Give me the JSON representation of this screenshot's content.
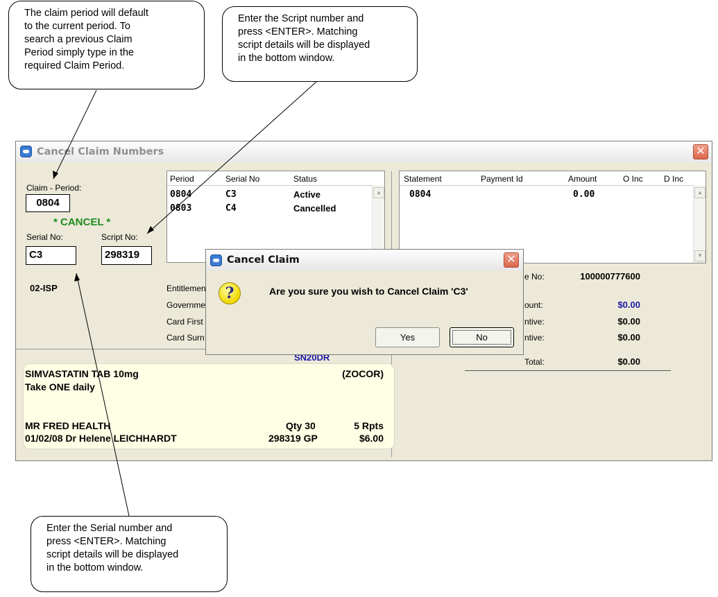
{
  "callouts": {
    "period": "The claim period will default\nto the current period. To\nsearch a previous Claim\nPeriod simply type in the\nrequired Claim Period.",
    "script": "Enter the Script number and\npress <ENTER>. Matching\nscript details will be displayed\nin the bottom window.",
    "serial": "Enter the Serial number and\npress <ENTER>. Matching\nscript details will be displayed\nin the bottom window."
  },
  "window": {
    "title": "Cancel Claim Numbers",
    "claim_period_label": "Claim - Period:",
    "claim_period_value": "0804",
    "cancel_banner": "* CANCEL *",
    "serial_label": "Serial No:",
    "serial_value": "C3",
    "script_label": "Script No:",
    "script_value": "298319",
    "code": "02-ISP",
    "left_labels": [
      "Entitlemen",
      "Governme",
      "Card First",
      "Card Surn"
    ],
    "blue_code": "SN20DR"
  },
  "claims_list": {
    "headers": [
      "Period",
      "Serial No",
      "Status"
    ],
    "rows": [
      {
        "period": "0804",
        "serial": "C3",
        "status": "Active"
      },
      {
        "period": "0803",
        "serial": "C4",
        "status": "Cancelled"
      }
    ]
  },
  "statements_list": {
    "headers": [
      "Statement",
      "Payment Id",
      "Amount",
      "O Inc",
      "D Inc"
    ],
    "rows": [
      {
        "statement": "0804",
        "payment_id": "",
        "amount": "0.00"
      }
    ]
  },
  "totals": {
    "labels": [
      "e No:",
      "ount:",
      "ntive:",
      "ntive:",
      "Total:"
    ],
    "values": [
      "100000777600",
      "$0.00",
      "$0.00",
      "$0.00",
      "$0.00"
    ],
    "value_colors": [
      "#000000",
      "#1a1aa6",
      "#000000",
      "#000000",
      "#000000"
    ]
  },
  "script_details": {
    "drug": "SIMVASTATIN TAB 10mg",
    "brand": "(ZOCOR)",
    "directions": "Take ONE daily",
    "patient": "MR FRED HEALTH",
    "qty": "Qty 30",
    "repeats": "5 Rpts",
    "date_doctor": "01/02/08  Dr Helene LEICHHARDT",
    "script_gp": "298319  GP",
    "price": "$6.00"
  },
  "dialog": {
    "title": "Cancel Claim",
    "message": "Are you sure you wish to Cancel Claim 'C3'",
    "yes_label": "Yes",
    "no_label": "No"
  }
}
